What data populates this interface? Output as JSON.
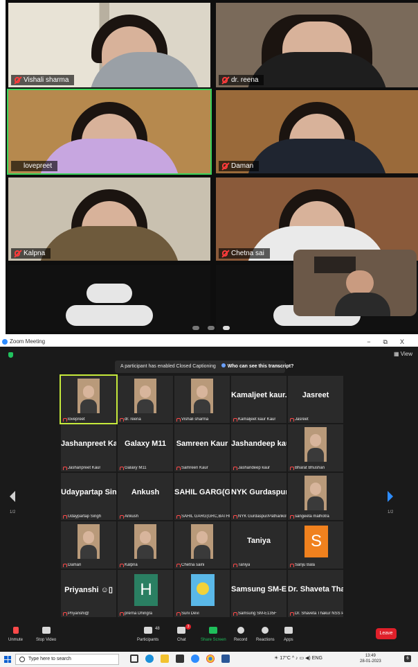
{
  "mobile": {
    "tiles": [
      {
        "name": "Vishali sharma"
      },
      {
        "name": "dr. reena"
      },
      {
        "name": "lovepreet"
      },
      {
        "name": "Daman"
      },
      {
        "name": "Kalpna"
      },
      {
        "name": "Chetna sai"
      }
    ]
  },
  "window": {
    "title": "Zoom Meeting",
    "minimize": "−",
    "restore": "⧉",
    "close": "X",
    "view_label": "View"
  },
  "banner": {
    "text": "A participant has enabled Closed Captioning",
    "link": "Who can see this transcript?",
    "close": "×"
  },
  "grid": {
    "page_left": "1/2",
    "page_right": "1/2",
    "cells": [
      {
        "big": "",
        "label": "lovepreet",
        "kind": "video",
        "active": true
      },
      {
        "big": "",
        "label": "dr. reena",
        "kind": "video"
      },
      {
        "big": "",
        "label": "Vishali sharma",
        "kind": "video"
      },
      {
        "big": "Kamaljeet kaur...",
        "label": "Kamaljeet kaur Kaur",
        "kind": "name"
      },
      {
        "big": "Jasreet",
        "label": "Jasreet",
        "kind": "name"
      },
      {
        "big": "Jashanpreet Kaur",
        "label": "Jashanpreet Kaur",
        "kind": "name"
      },
      {
        "big": "Galaxy M11",
        "label": "Galaxy M11",
        "kind": "name"
      },
      {
        "big": "Samreen Kaur",
        "label": "Samreen Kaur",
        "kind": "name"
      },
      {
        "big": "Jashandeep kaur",
        "label": "Jashandeep kaur",
        "kind": "name"
      },
      {
        "big": "",
        "label": "Bharat Bhushan",
        "kind": "video"
      },
      {
        "big": "Udaypartap Sin...",
        "label": "Udaypartap Singh",
        "kind": "name"
      },
      {
        "big": "Ankush",
        "label": "Ankush",
        "kind": "name"
      },
      {
        "big": "SAHIL GARG(G...",
        "label": "SAHIL GARG(GRC,BATHIN...",
        "kind": "name"
      },
      {
        "big": "NYK Gurdaspur...",
        "label": "NYK Gurdaspur/Pathankot",
        "kind": "name"
      },
      {
        "big": "",
        "label": "sangeeta malhotra",
        "kind": "video"
      },
      {
        "big": "",
        "label": "Daman",
        "kind": "video"
      },
      {
        "big": "",
        "label": "Kalpna",
        "kind": "video"
      },
      {
        "big": "",
        "label": "Chetna saini",
        "kind": "video"
      },
      {
        "big": "Taniya",
        "label": "Taniya",
        "kind": "name"
      },
      {
        "big": "S",
        "label": "Sanju Bala",
        "kind": "letter",
        "color": "#f0811e"
      },
      {
        "big": "Priyanshi ☺▯",
        "label": "Priyanshi@",
        "kind": "name"
      },
      {
        "big": "H",
        "label": "prerna Dhingra",
        "kind": "letter",
        "color": "#2a7f62"
      },
      {
        "big": "",
        "label": "Suni Devi",
        "kind": "image"
      },
      {
        "big": "Samsung SM-E...",
        "label": "Samsung SM-E135F",
        "kind": "name"
      },
      {
        "big": "Dr. Shaveta Tha...",
        "label": "Dr. Shaveta Thakur NSS PO",
        "kind": "name"
      }
    ]
  },
  "toolbar": {
    "unmute": "Unmute",
    "stop_video": "Stop Video",
    "participants": "Participants",
    "participants_count": "48",
    "chat": "Chat",
    "chat_badge": "3",
    "share": "Share Screen",
    "record": "Record",
    "reactions": "Reactions",
    "apps": "Apps",
    "leave": "Leave"
  },
  "taskbar": {
    "search_placeholder": "Type here to search",
    "weather": "17°C",
    "lang": "ENG",
    "time": "13:49",
    "date": "28-01-2023",
    "notif_count": "6"
  },
  "colors": {
    "active_speaker": "#c6ea3b",
    "share_green": "#1fbf5b",
    "leave_red": "#e0202a",
    "zoom_blue": "#2d8cff"
  }
}
